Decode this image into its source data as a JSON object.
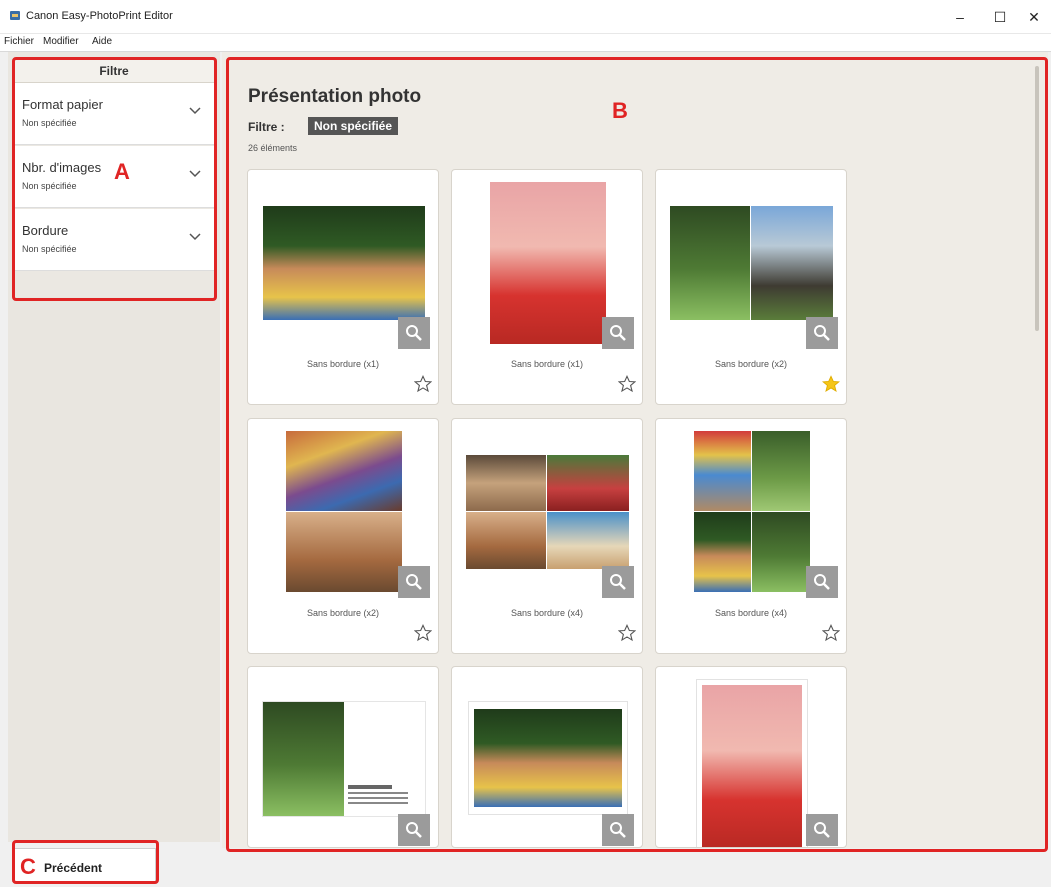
{
  "window": {
    "title": "Canon Easy-PhotoPrint Editor",
    "minimize": "–",
    "maximize": "☐",
    "close": "✕"
  },
  "menu": [
    "Fichier",
    "Modifier",
    "Aide"
  ],
  "filter_panel": {
    "header": "Filtre",
    "items": [
      {
        "title": "Format papier",
        "value": "Non spécifiée"
      },
      {
        "title": "Nbr. d'images",
        "value": "Non spécifiée"
      },
      {
        "title": "Bordure",
        "value": "Non spécifiée"
      }
    ]
  },
  "main": {
    "title": "Présentation photo",
    "filter_label": "Filtre :",
    "filter_value": "Non spécifiée",
    "count": "26 éléments",
    "cards": [
      {
        "caption": "Sans bordure (x1)",
        "favorite": false
      },
      {
        "caption": "Sans bordure (x1)",
        "favorite": false
      },
      {
        "caption": "Sans bordure (x2)",
        "favorite": true
      },
      {
        "caption": "Sans bordure (x2)",
        "favorite": false
      },
      {
        "caption": "Sans bordure (x4)",
        "favorite": false
      },
      {
        "caption": "Sans bordure (x4)",
        "favorite": false
      },
      {
        "caption": "",
        "favorite": false
      },
      {
        "caption": "",
        "favorite": false
      },
      {
        "caption": "",
        "favorite": false
      }
    ]
  },
  "footer": {
    "prev_label": "Précédent"
  },
  "annotations": {
    "a": "A",
    "b": "B",
    "c": "C"
  },
  "colors": {
    "annotation": "#e02424",
    "favorite_star": "#f5c518",
    "zoom_button": "#9b9b9b",
    "filter_chip": "#555555"
  }
}
